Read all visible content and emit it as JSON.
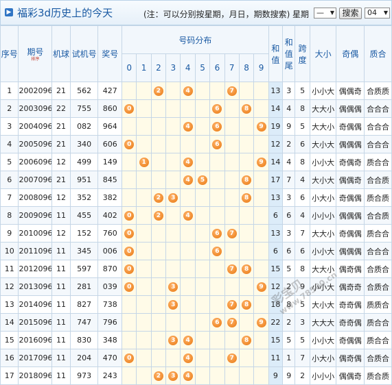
{
  "header": {
    "title": "福彩3d历史上的今天",
    "note": "(注：可以分别按星期，月日，期数搜索)",
    "weekday_label": "星期",
    "weekday_value": "—",
    "search_button": "搜索",
    "number_value": "04"
  },
  "columns": {
    "seq": "序号",
    "issue": "期号",
    "sort_label": "排序",
    "machine": "机球",
    "test_no": "试机号",
    "prize_no": "奖号",
    "dist": "号码分布",
    "digits": [
      "0",
      "1",
      "2",
      "3",
      "4",
      "5",
      "6",
      "7",
      "8",
      "9"
    ],
    "sum": "和值",
    "sum_tail": "和值尾",
    "span": "跨度",
    "size": "大小",
    "parity": "奇偶",
    "prime": "质合"
  },
  "rows": [
    {
      "seq": "1",
      "issue": "2002096",
      "machine": "21",
      "test": "562",
      "prize": "427",
      "sum": "13",
      "tail": "3",
      "span": "5",
      "size": "小小大",
      "parity": "偶偶奇",
      "prime": "合质质"
    },
    {
      "seq": "2",
      "issue": "2003096",
      "machine": "22",
      "test": "755",
      "prize": "860",
      "sum": "14",
      "tail": "4",
      "span": "8",
      "size": "大大小",
      "parity": "偶偶偶",
      "prime": "合合合"
    },
    {
      "seq": "3",
      "issue": "2004096",
      "machine": "21",
      "test": "082",
      "prize": "964",
      "sum": "19",
      "tail": "9",
      "span": "5",
      "size": "大大小",
      "parity": "奇偶偶",
      "prime": "合合合"
    },
    {
      "seq": "4",
      "issue": "2005096",
      "machine": "21",
      "test": "340",
      "prize": "606",
      "sum": "12",
      "tail": "2",
      "span": "6",
      "size": "大小大",
      "parity": "偶偶偶",
      "prime": "合合合"
    },
    {
      "seq": "5",
      "issue": "2006096",
      "machine": "12",
      "test": "499",
      "prize": "149",
      "sum": "14",
      "tail": "4",
      "span": "8",
      "size": "小小大",
      "parity": "奇偶奇",
      "prime": "质合合"
    },
    {
      "seq": "6",
      "issue": "2007096",
      "machine": "21",
      "test": "951",
      "prize": "845",
      "sum": "17",
      "tail": "7",
      "span": "4",
      "size": "大小大",
      "parity": "偶偶奇",
      "prime": "合合质"
    },
    {
      "seq": "7",
      "issue": "2008096",
      "machine": "12",
      "test": "352",
      "prize": "382",
      "sum": "13",
      "tail": "3",
      "span": "6",
      "size": "小大小",
      "parity": "奇偶偶",
      "prime": "质合质"
    },
    {
      "seq": "8",
      "issue": "2009096",
      "machine": "11",
      "test": "455",
      "prize": "402",
      "sum": "6",
      "tail": "6",
      "span": "4",
      "size": "小小小",
      "parity": "偶偶偶",
      "prime": "合合质"
    },
    {
      "seq": "9",
      "issue": "2010096",
      "machine": "12",
      "test": "152",
      "prize": "760",
      "sum": "13",
      "tail": "3",
      "span": "7",
      "size": "大大小",
      "parity": "奇偶偶",
      "prime": "质合合"
    },
    {
      "seq": "10",
      "issue": "2011096",
      "machine": "11",
      "test": "345",
      "prize": "006",
      "sum": "6",
      "tail": "6",
      "span": "6",
      "size": "小小大",
      "parity": "偶偶偶",
      "prime": "合合合"
    },
    {
      "seq": "11",
      "issue": "2012096",
      "machine": "11",
      "test": "597",
      "prize": "870",
      "sum": "15",
      "tail": "5",
      "span": "8",
      "size": "大大小",
      "parity": "偶奇偶",
      "prime": "合质合"
    },
    {
      "seq": "12",
      "issue": "2013096",
      "machine": "11",
      "test": "281",
      "prize": "039",
      "sum": "12",
      "tail": "2",
      "span": "9",
      "size": "小小大",
      "parity": "偶奇奇",
      "prime": "合质合"
    },
    {
      "seq": "13",
      "issue": "2014096",
      "machine": "11",
      "test": "827",
      "prize": "738",
      "sum": "18",
      "tail": "8",
      "span": "5",
      "size": "大小大",
      "parity": "奇奇偶",
      "prime": "质质合"
    },
    {
      "seq": "14",
      "issue": "2015096",
      "machine": "11",
      "test": "747",
      "prize": "796",
      "sum": "22",
      "tail": "2",
      "span": "3",
      "size": "大大大",
      "parity": "奇奇偶",
      "prime": "质合合"
    },
    {
      "seq": "15",
      "issue": "2016096",
      "machine": "11",
      "test": "830",
      "prize": "348",
      "sum": "15",
      "tail": "5",
      "span": "5",
      "size": "小小大",
      "parity": "奇偶偶",
      "prime": "质合合"
    },
    {
      "seq": "16",
      "issue": "2017096",
      "machine": "11",
      "test": "204",
      "prize": "470",
      "sum": "11",
      "tail": "1",
      "span": "7",
      "size": "小大小",
      "parity": "偶奇偶",
      "prime": "合质合"
    },
    {
      "seq": "17",
      "issue": "2018096",
      "machine": "11",
      "test": "973",
      "prize": "243",
      "sum": "9",
      "tail": "9",
      "span": "2",
      "size": "小小小",
      "parity": "偶偶奇",
      "prime": "质合质"
    }
  ],
  "watermark": {
    "text": "彩宝贝",
    "url": "www.78500.cn"
  }
}
